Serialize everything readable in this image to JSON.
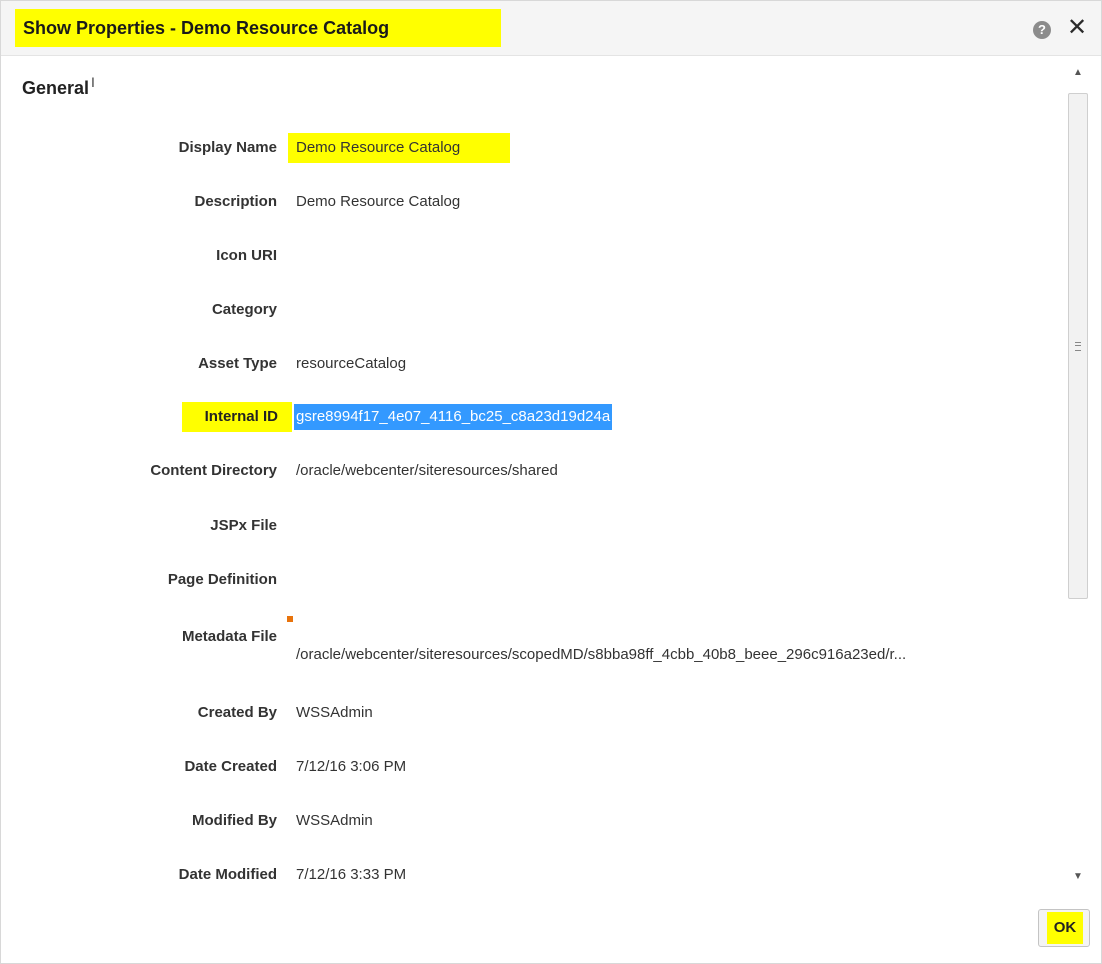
{
  "dialog": {
    "title": "Show Properties - Demo Resource Catalog",
    "help_icon": "help-icon",
    "close_icon": "close-icon",
    "help_glyph": "?",
    "close_glyph": "✕"
  },
  "section": {
    "title": "General"
  },
  "properties": {
    "display_name": {
      "label": "Display Name",
      "value": "Demo Resource Catalog"
    },
    "description": {
      "label": "Description",
      "value": "Demo Resource Catalog"
    },
    "icon_uri": {
      "label": "Icon URI",
      "value": ""
    },
    "category": {
      "label": "Category",
      "value": ""
    },
    "asset_type": {
      "label": "Asset Type",
      "value": "resourceCatalog"
    },
    "internal_id": {
      "label": "Internal ID",
      "value": "gsre8994f17_4e07_4116_bc25_c8a23d19d24a"
    },
    "content_directory": {
      "label": "Content Directory",
      "value": "/oracle/webcenter/siteresources/shared"
    },
    "jspx_file": {
      "label": "JSPx File",
      "value": ""
    },
    "page_definition": {
      "label": "Page Definition",
      "value": ""
    },
    "metadata_file": {
      "label": "Metadata File",
      "value": "/oracle/webcenter/siteresources/scopedMD/s8bba98ff_4cbb_40b8_beee_296c916a23ed/r..."
    },
    "created_by": {
      "label": "Created By",
      "value": "WSSAdmin"
    },
    "date_created": {
      "label": "Date Created",
      "value": "7/12/16 3:06 PM"
    },
    "modified_by": {
      "label": "Modified By",
      "value": "WSSAdmin"
    },
    "date_modified": {
      "label": "Date Modified",
      "value": "7/12/16 3:33 PM"
    }
  },
  "footer": {
    "ok_label": "OK"
  },
  "colors": {
    "highlight_yellow": "#ffff00",
    "selection_blue": "#3399ff",
    "marker_orange": "#e8730c"
  }
}
